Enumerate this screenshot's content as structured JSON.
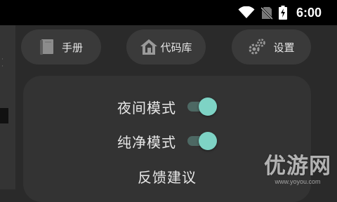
{
  "status_bar": {
    "time": "6:00",
    "icons": [
      "wifi-icon",
      "no-sim-icon",
      "battery-charging-icon"
    ]
  },
  "nav": {
    "items": [
      {
        "label": "手册",
        "icon": "book-icon"
      },
      {
        "label": "代码库",
        "icon": "house-icon"
      },
      {
        "label": "设置",
        "icon": "gear-icon"
      }
    ]
  },
  "settings": {
    "night_mode": {
      "label": "夜间模式",
      "on": true
    },
    "clean_mode": {
      "label": "纯净模式",
      "on": true
    },
    "feedback": {
      "label": "反馈建议"
    }
  },
  "colors": {
    "toggle_thumb": "#7ed3c5",
    "toggle_track": "#4d6863",
    "panel": "#333333",
    "background": "#2a2a2a"
  },
  "watermark": {
    "main": "优游网",
    "sub": "www.yoyou.com"
  }
}
